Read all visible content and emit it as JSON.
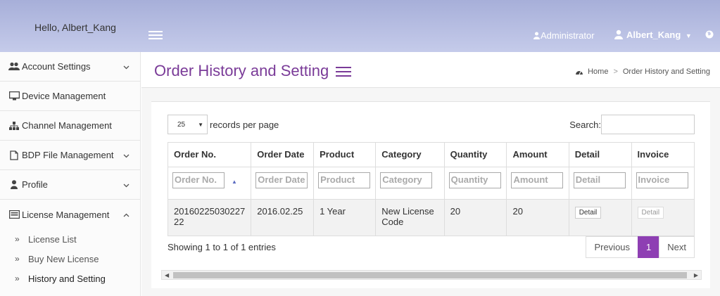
{
  "topbar": {
    "greeting": "Hello, Albert_Kang",
    "role": "Administrator",
    "user": "Albert_Kang"
  },
  "sidebar": {
    "items": [
      {
        "label": "Account Settings",
        "icon": "users-icon"
      },
      {
        "label": "Device Management",
        "icon": "monitor-icon"
      },
      {
        "label": "Channel Management",
        "icon": "sitemap-icon"
      },
      {
        "label": "BDP File Management",
        "icon": "file-icon"
      },
      {
        "label": "Profile",
        "icon": "user-icon"
      },
      {
        "label": "License Management",
        "icon": "list-icon"
      }
    ],
    "subitems": [
      {
        "label": "License List"
      },
      {
        "label": "Buy New License"
      },
      {
        "label": "History and Setting"
      }
    ]
  },
  "page": {
    "title": "Order History and Setting",
    "breadcrumb": [
      "Home",
      "Order History and Setting"
    ]
  },
  "table": {
    "length_value": "25",
    "length_label": "records per page",
    "search_label": "Search:",
    "columns": [
      "Order No.",
      "Order Date",
      "Product",
      "Category",
      "Quantity",
      "Amount",
      "Detail",
      "Invoice"
    ],
    "filters": [
      "Order No.",
      "Order Date",
      "Product",
      "Category",
      "Quantity",
      "Amount",
      "Detail",
      "Invoice"
    ],
    "rows": [
      {
        "order_no": "20160225030227 22",
        "order_date": "2016.02.25",
        "product": "1 Year",
        "category": "New License Code",
        "quantity": "20",
        "amount": "20",
        "detail": "Detail",
        "invoice": "Detail"
      }
    ],
    "info": "Showing 1 to 1 of 1 entries",
    "pager": {
      "previous": "Previous",
      "current": "1",
      "next": "Next"
    }
  },
  "colors": {
    "accent": "#8e3fb3",
    "title": "#7a3b98",
    "topbar": "#a7afd9"
  }
}
